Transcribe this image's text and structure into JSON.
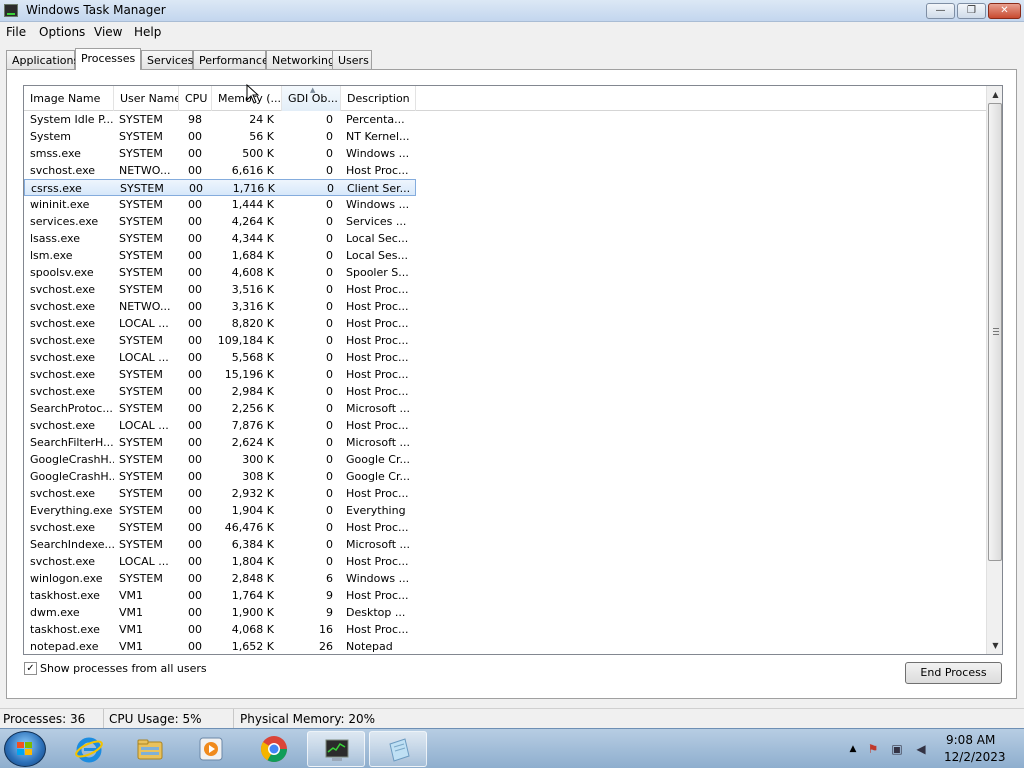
{
  "window": {
    "title": "Windows Task Manager",
    "minimize": "—",
    "maximize": "❐",
    "close": "✕"
  },
  "menu": [
    "File",
    "Options",
    "View",
    "Help"
  ],
  "tabs": [
    "Applications",
    "Processes",
    "Services",
    "Performance",
    "Networking",
    "Users"
  ],
  "active_tab": "Processes",
  "columns": {
    "image_name": "Image Name",
    "user_name": "User Name",
    "cpu": "CPU",
    "memory": "Memory (...",
    "gdi": "GDI Ob...",
    "description": "Description"
  },
  "sort_indicator": "▲",
  "processes": [
    {
      "name": "System Idle P...",
      "user": "SYSTEM",
      "cpu": "98",
      "mem": "24 K",
      "gdi": "0",
      "desc": "Percenta..."
    },
    {
      "name": "System",
      "user": "SYSTEM",
      "cpu": "00",
      "mem": "56 K",
      "gdi": "0",
      "desc": "NT Kernel..."
    },
    {
      "name": "smss.exe",
      "user": "SYSTEM",
      "cpu": "00",
      "mem": "500 K",
      "gdi": "0",
      "desc": "Windows ..."
    },
    {
      "name": "svchost.exe",
      "user": "NETWO...",
      "cpu": "00",
      "mem": "6,616 K",
      "gdi": "0",
      "desc": "Host Proc..."
    },
    {
      "name": "csrss.exe",
      "user": "SYSTEM",
      "cpu": "00",
      "mem": "1,716 K",
      "gdi": "0",
      "desc": "Client Ser..."
    },
    {
      "name": "wininit.exe",
      "user": "SYSTEM",
      "cpu": "00",
      "mem": "1,444 K",
      "gdi": "0",
      "desc": "Windows ..."
    },
    {
      "name": "services.exe",
      "user": "SYSTEM",
      "cpu": "00",
      "mem": "4,264 K",
      "gdi": "0",
      "desc": "Services ..."
    },
    {
      "name": "lsass.exe",
      "user": "SYSTEM",
      "cpu": "00",
      "mem": "4,344 K",
      "gdi": "0",
      "desc": "Local Sec..."
    },
    {
      "name": "lsm.exe",
      "user": "SYSTEM",
      "cpu": "00",
      "mem": "1,684 K",
      "gdi": "0",
      "desc": "Local Ses..."
    },
    {
      "name": "spoolsv.exe",
      "user": "SYSTEM",
      "cpu": "00",
      "mem": "4,608 K",
      "gdi": "0",
      "desc": "Spooler S..."
    },
    {
      "name": "svchost.exe",
      "user": "SYSTEM",
      "cpu": "00",
      "mem": "3,516 K",
      "gdi": "0",
      "desc": "Host Proc..."
    },
    {
      "name": "svchost.exe",
      "user": "NETWO...",
      "cpu": "00",
      "mem": "3,316 K",
      "gdi": "0",
      "desc": "Host Proc..."
    },
    {
      "name": "svchost.exe",
      "user": "LOCAL ...",
      "cpu": "00",
      "mem": "8,820 K",
      "gdi": "0",
      "desc": "Host Proc..."
    },
    {
      "name": "svchost.exe",
      "user": "SYSTEM",
      "cpu": "00",
      "mem": "109,184 K",
      "gdi": "0",
      "desc": "Host Proc..."
    },
    {
      "name": "svchost.exe",
      "user": "LOCAL ...",
      "cpu": "00",
      "mem": "5,568 K",
      "gdi": "0",
      "desc": "Host Proc..."
    },
    {
      "name": "svchost.exe",
      "user": "SYSTEM",
      "cpu": "00",
      "mem": "15,196 K",
      "gdi": "0",
      "desc": "Host Proc..."
    },
    {
      "name": "svchost.exe",
      "user": "SYSTEM",
      "cpu": "00",
      "mem": "2,984 K",
      "gdi": "0",
      "desc": "Host Proc..."
    },
    {
      "name": "SearchProtoc...",
      "user": "SYSTEM",
      "cpu": "00",
      "mem": "2,256 K",
      "gdi": "0",
      "desc": "Microsoft ..."
    },
    {
      "name": "svchost.exe",
      "user": "LOCAL ...",
      "cpu": "00",
      "mem": "7,876 K",
      "gdi": "0",
      "desc": "Host Proc..."
    },
    {
      "name": "SearchFilterH...",
      "user": "SYSTEM",
      "cpu": "00",
      "mem": "2,624 K",
      "gdi": "0",
      "desc": "Microsoft ..."
    },
    {
      "name": "GoogleCrashH...",
      "user": "SYSTEM",
      "cpu": "00",
      "mem": "300 K",
      "gdi": "0",
      "desc": "Google Cr..."
    },
    {
      "name": "GoogleCrashH...",
      "user": "SYSTEM",
      "cpu": "00",
      "mem": "308 K",
      "gdi": "0",
      "desc": "Google Cr..."
    },
    {
      "name": "svchost.exe",
      "user": "SYSTEM",
      "cpu": "00",
      "mem": "2,932 K",
      "gdi": "0",
      "desc": "Host Proc..."
    },
    {
      "name": "Everything.exe",
      "user": "SYSTEM",
      "cpu": "00",
      "mem": "1,904 K",
      "gdi": "0",
      "desc": "Everything"
    },
    {
      "name": "svchost.exe",
      "user": "SYSTEM",
      "cpu": "00",
      "mem": "46,476 K",
      "gdi": "0",
      "desc": "Host Proc..."
    },
    {
      "name": "SearchIndexe...",
      "user": "SYSTEM",
      "cpu": "00",
      "mem": "6,384 K",
      "gdi": "0",
      "desc": "Microsoft ..."
    },
    {
      "name": "svchost.exe",
      "user": "LOCAL ...",
      "cpu": "00",
      "mem": "1,804 K",
      "gdi": "0",
      "desc": "Host Proc..."
    },
    {
      "name": "winlogon.exe",
      "user": "SYSTEM",
      "cpu": "00",
      "mem": "2,848 K",
      "gdi": "6",
      "desc": "Windows ..."
    },
    {
      "name": "taskhost.exe",
      "user": "VM1",
      "cpu": "00",
      "mem": "1,764 K",
      "gdi": "9",
      "desc": "Host Proc..."
    },
    {
      "name": "dwm.exe",
      "user": "VM1",
      "cpu": "00",
      "mem": "1,900 K",
      "gdi": "9",
      "desc": "Desktop ..."
    },
    {
      "name": "taskhost.exe",
      "user": "VM1",
      "cpu": "00",
      "mem": "4,068 K",
      "gdi": "16",
      "desc": "Host Proc..."
    },
    {
      "name": "notepad.exe",
      "user": "VM1",
      "cpu": "00",
      "mem": "1,652 K",
      "gdi": "26",
      "desc": "Notepad"
    }
  ],
  "selected_process": "csrss.exe",
  "show_all_users": {
    "label": "Show processes from all users",
    "checked": "✓"
  },
  "end_process_label": "End Process",
  "status": {
    "processes": "Processes: 36",
    "cpu": "CPU Usage: 5%",
    "memory": "Physical Memory: 20%"
  },
  "taskbar": {
    "items": [
      "start-orb",
      "internet-explorer-icon",
      "windows-explorer-icon",
      "media-player-icon",
      "chrome-icon",
      "task-manager-icon",
      "notepad-icon"
    ],
    "clock_time": "9:08 AM",
    "clock_date": "12/2/2023"
  },
  "colors": {
    "selection": "#d7e8fa",
    "selection_border": "#84acdd",
    "taskbar": "#9fbcd9"
  }
}
